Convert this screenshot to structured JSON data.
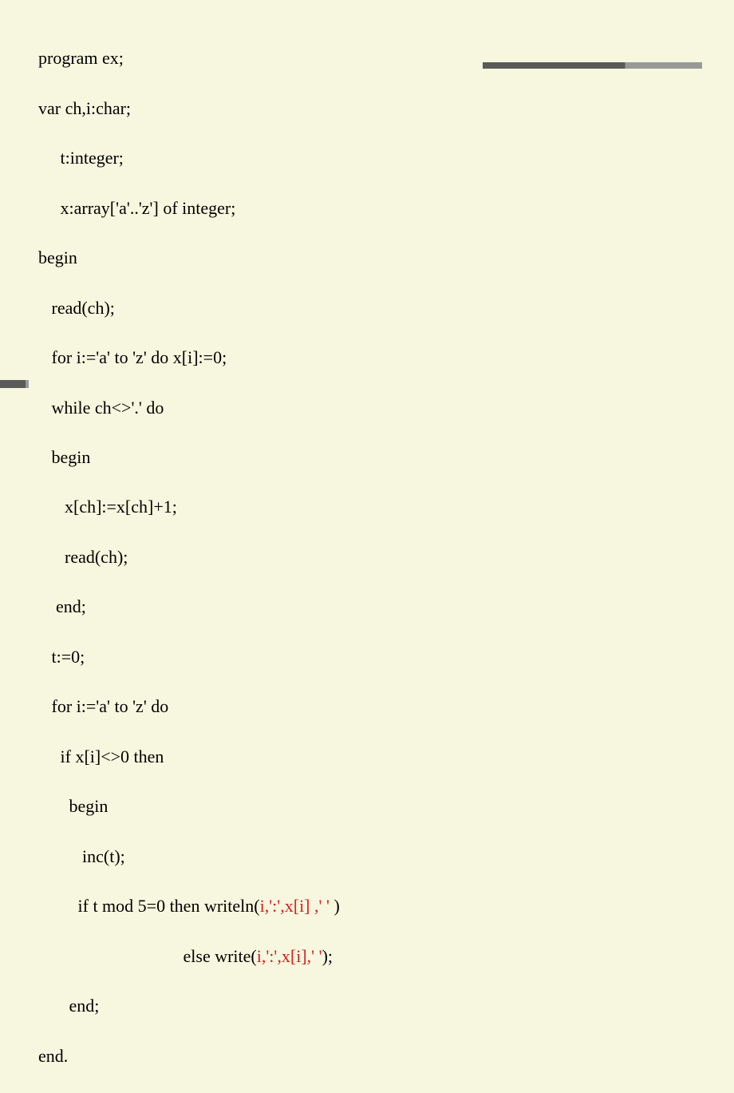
{
  "code": {
    "l1": "program ex;",
    "l2": "var ch,i:char;",
    "l3": "     t:integer;",
    "l4": "     x:array['a'..'z'] of integer;",
    "l5": "begin",
    "l6": "   read(ch);",
    "l7": "   for i:='a' to 'z' do x[i]:=0;",
    "l8": "   while ch<>'.' do",
    "l9": "   begin",
    "l10": "      x[ch]:=x[ch]+1;",
    "l11": "      read(ch);",
    "l12": "    end;",
    "l13": "   t:=0;",
    "l14": "   for i:='a' to 'z' do",
    "l15": "     if x[i]<>0 then",
    "l16": "       begin",
    "l17": "          inc(t);",
    "l18a": "         if t mod 5=0 then writeln(",
    "l18r": "i,':',x[i] ,' '",
    "l18b": " )",
    "l19a": "                                 else write(",
    "l19r": "i,':',x[i],' '",
    "l19b": ");",
    "l20": "       end;",
    "l21": "end."
  }
}
